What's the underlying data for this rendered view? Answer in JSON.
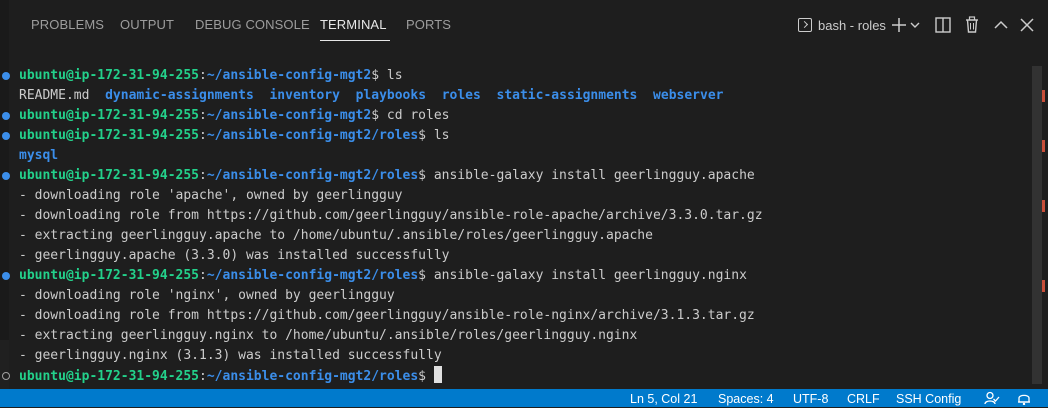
{
  "panel": {
    "tabs": [
      "PROBLEMS",
      "OUTPUT",
      "DEBUG CONSOLE",
      "TERMINAL",
      "PORTS"
    ],
    "active_tab": "TERMINAL",
    "terminal_selector": "bash - roles"
  },
  "prompt": {
    "user_host": "ubuntu@ip-172-31-94-255",
    "path_root": "~/ansible-config-mgt2",
    "path_roles": "~/ansible-config-mgt2/roles"
  },
  "commands": {
    "ls": "ls",
    "cd_roles": "cd roles",
    "install_apache": "ansible-galaxy install geerlingguy.apache",
    "install_nginx": "ansible-galaxy install geerlingguy.nginx"
  },
  "ls_output": {
    "readme": "README.md",
    "dirs": [
      "dynamic-assignments",
      "inventory",
      "playbooks",
      "roles",
      "static-assignments",
      "webserver"
    ]
  },
  "roles_ls_output": "mysql",
  "apache_output": [
    "- downloading role 'apache', owned by geerlingguy",
    "- downloading role from https://github.com/geerlingguy/ansible-role-apache/archive/3.3.0.tar.gz",
    "- extracting geerlingguy.apache to /home/ubuntu/.ansible/roles/geerlingguy.apache",
    "- geerlingguy.apache (3.3.0) was installed successfully"
  ],
  "nginx_output": [
    "- downloading role 'nginx', owned by geerlingguy",
    "- downloading role from https://github.com/geerlingguy/ansible-role-nginx/archive/3.1.3.tar.gz",
    "- extracting geerlingguy.nginx to /home/ubuntu/.ansible/roles/geerlingguy.nginx",
    "- geerlingguy.nginx (3.1.3) was installed successfully"
  ],
  "statusbar": {
    "position": "Ln 5, Col 21",
    "spaces": "Spaces: 4",
    "encoding": "UTF-8",
    "eol": "CRLF",
    "language": "SSH Config"
  },
  "colors": {
    "accent": "#007acc",
    "user": "#23d18b",
    "path": "#3b8eea"
  }
}
